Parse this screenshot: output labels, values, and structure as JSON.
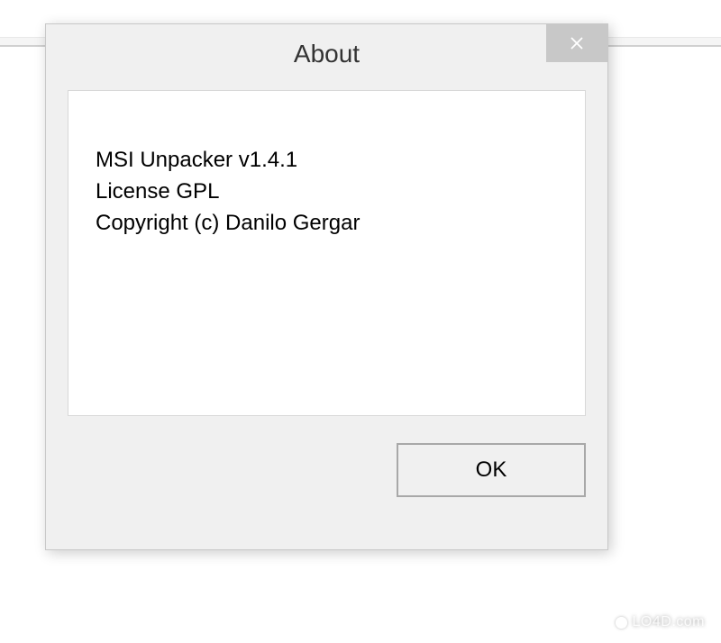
{
  "dialog": {
    "title": "About",
    "content": {
      "line1": "MSI Unpacker v1.4.1",
      "line2": "License GPL",
      "line3": "Copyright (c) Danilo Gergar"
    },
    "ok_label": "OK"
  },
  "watermark": {
    "text": "LO4D.com"
  }
}
